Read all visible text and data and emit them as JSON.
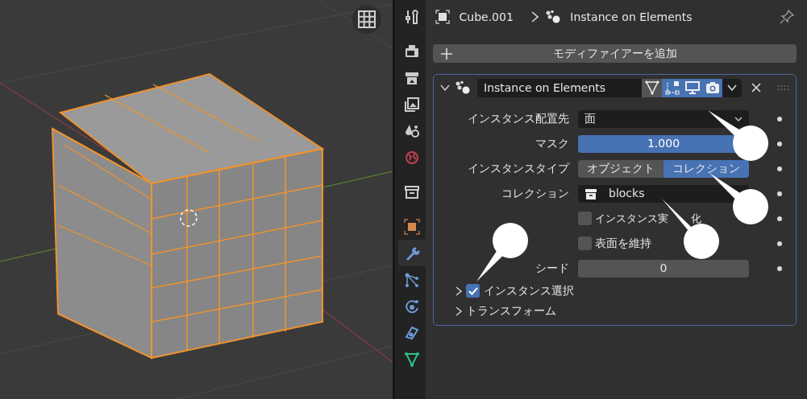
{
  "sidebar": {
    "tabs": [
      {
        "kind": "tool",
        "selected": false
      },
      {
        "kind": "render",
        "selected": false
      },
      {
        "kind": "output",
        "selected": false
      },
      {
        "kind": "viewlayer",
        "selected": false
      },
      {
        "kind": "scene",
        "selected": false
      },
      {
        "kind": "world",
        "selected": false
      },
      {
        "kind": "collection",
        "selected": false
      },
      {
        "kind": "object",
        "selected": false
      },
      {
        "kind": "modifier",
        "selected": true
      },
      {
        "kind": "particles",
        "selected": false
      },
      {
        "kind": "physics",
        "selected": false
      },
      {
        "kind": "constraint",
        "selected": false
      },
      {
        "kind": "data",
        "selected": false
      }
    ]
  },
  "breadcrumb": {
    "object_name": "Cube.001",
    "modifier_name": "Instance on Elements",
    "pinned": false
  },
  "add_modifier_button": {
    "label": "モディファイアーを追加"
  },
  "modifier": {
    "name": "Instance on Elements",
    "expanded": true,
    "toggles": [
      {
        "kind": "filter",
        "on": false
      },
      {
        "kind": "editmode",
        "on": true
      },
      {
        "kind": "viewport",
        "on": true
      },
      {
        "kind": "render",
        "on": true
      }
    ],
    "properties": [
      {
        "kind": "dropdown",
        "label": "インスタンス配置先",
        "value": "面"
      },
      {
        "kind": "slider",
        "label": "マスク",
        "value": "1.000",
        "level": 1
      },
      {
        "kind": "segmented",
        "label": "インスタンスタイプ",
        "options": [
          {
            "label": "オブジェクト",
            "selected": false
          },
          {
            "label": "コレクション",
            "selected": true
          }
        ]
      },
      {
        "kind": "collection",
        "label": "コレクション",
        "value": "blocks"
      },
      {
        "kind": "checkbox",
        "label": "インスタンス実",
        "label_end": "化",
        "checked": false
      },
      {
        "kind": "checkbox",
        "label": "表面を維持",
        "checked": false
      },
      {
        "kind": "number",
        "label": "シード",
        "value": "0"
      }
    ],
    "subpanels": [
      {
        "label": "インスタンス選択",
        "expanded": false,
        "kind": "toggle",
        "checked": true
      },
      {
        "label": "トランスフォーム",
        "expanded": false,
        "kind": "plain"
      }
    ]
  },
  "callouts": [
    {
      "kind": "bubble"
    },
    {
      "kind": "bubble"
    },
    {
      "kind": "bubble"
    },
    {
      "kind": "bubble"
    }
  ]
}
